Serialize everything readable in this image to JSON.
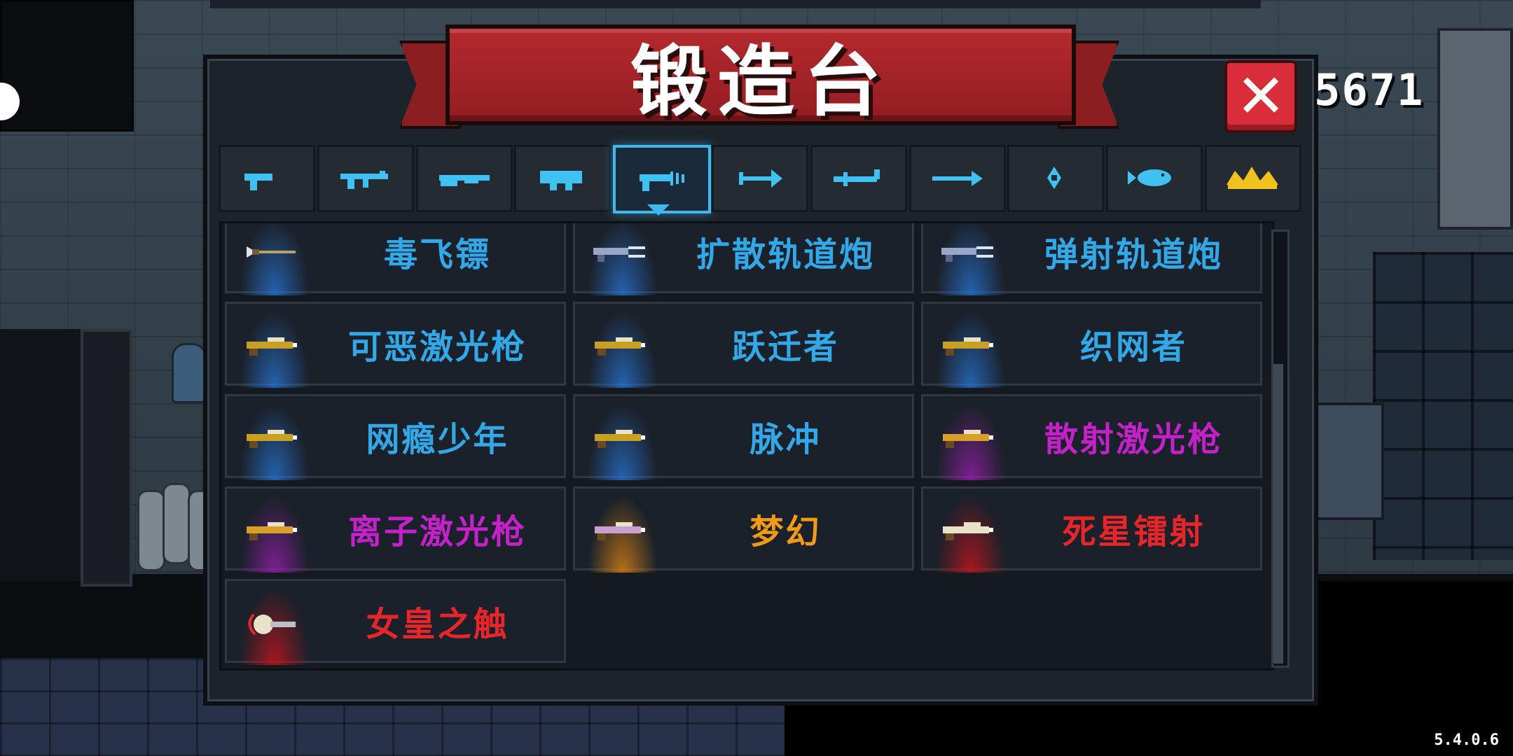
{
  "dialog": {
    "title": "锻造台",
    "close_label": "✕"
  },
  "hud": {
    "gem_count": "5671",
    "version": "5.4.0.6"
  },
  "tabs": [
    {
      "name": "pistol",
      "icon": "pistol-icon",
      "active": false
    },
    {
      "name": "rifle",
      "icon": "rifle-icon",
      "active": false
    },
    {
      "name": "shotgun",
      "icon": "shotgun-icon",
      "active": false
    },
    {
      "name": "cannon",
      "icon": "cannon-icon",
      "active": false
    },
    {
      "name": "laser",
      "icon": "laser-icon",
      "active": true
    },
    {
      "name": "bow",
      "icon": "bow-icon",
      "active": false
    },
    {
      "name": "melee",
      "icon": "melee-icon",
      "active": false
    },
    {
      "name": "spear",
      "icon": "spear-icon",
      "active": false
    },
    {
      "name": "throwing",
      "icon": "shuriken-icon",
      "active": false
    },
    {
      "name": "special",
      "icon": "fish-icon",
      "active": false
    },
    {
      "name": "favorites",
      "icon": "crown-icon",
      "active": false
    }
  ],
  "colors": {
    "blue_name": "#33a8e8",
    "purple_name": "#c322c8",
    "orange_name": "#f09a18",
    "red_name": "#e8262a",
    "tab_icon": "#3fc2f2",
    "crown": "#f2c21c"
  },
  "weapons": [
    {
      "name": "毒飞镖",
      "rarity": "blue",
      "icon": "dart-icon"
    },
    {
      "name": "扩散轨道炮",
      "rarity": "blue",
      "icon": "railgun-icon"
    },
    {
      "name": "弹射轨道炮",
      "rarity": "blue",
      "icon": "railgun-icon"
    },
    {
      "name": "可恶激光枪",
      "rarity": "blue",
      "icon": "laser-gun-icon"
    },
    {
      "name": "跃迁者",
      "rarity": "blue",
      "icon": "laser-gun-icon"
    },
    {
      "name": "织网者",
      "rarity": "blue",
      "icon": "laser-gun-icon"
    },
    {
      "name": "网瘾少年",
      "rarity": "blue",
      "icon": "laser-gun-icon"
    },
    {
      "name": "脉冲",
      "rarity": "blue",
      "icon": "laser-gun-icon"
    },
    {
      "name": "散射激光枪",
      "rarity": "purple",
      "icon": "laser-gun-icon"
    },
    {
      "name": "离子激光枪",
      "rarity": "purple",
      "icon": "laser-gun-icon"
    },
    {
      "name": "梦幻",
      "rarity": "orange",
      "icon": "laser-gun-icon"
    },
    {
      "name": "死星镭射",
      "rarity": "red",
      "icon": "laser-gun-icon"
    },
    {
      "name": "女皇之触",
      "rarity": "red",
      "icon": "claw-icon"
    }
  ]
}
